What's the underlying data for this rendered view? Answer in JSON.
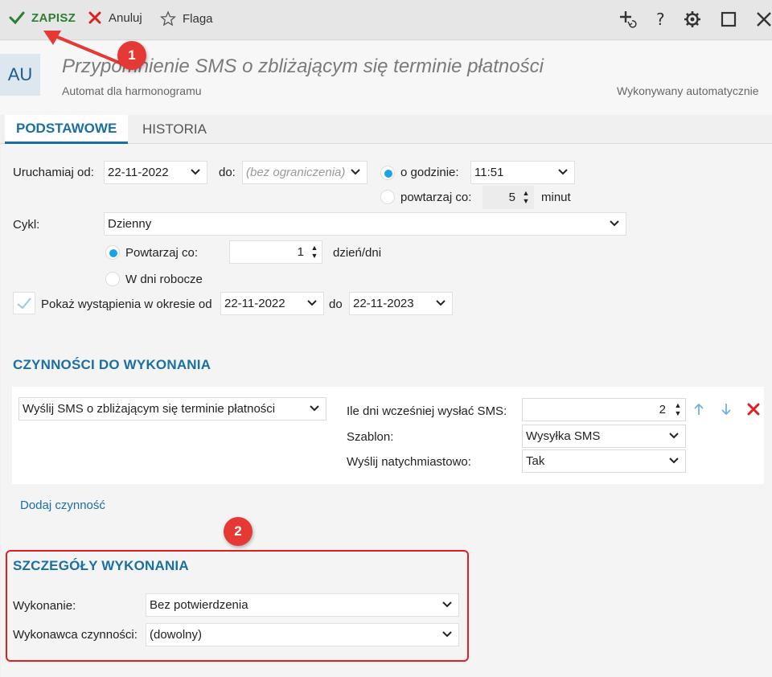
{
  "toolbar": {
    "save_label": "ZAPISZ",
    "cancel_label": "Anuluj",
    "flag_label": "Flaga"
  },
  "header": {
    "badge": "AU",
    "title": "Przypomnienie SMS o zbliżającym się terminie płatności",
    "subtitle": "Automat dla harmonogramu",
    "right_note": "Wykonywany automatycznie"
  },
  "tabs": [
    {
      "label": "PODSTAWOWE",
      "active": true
    },
    {
      "label": "HISTORIA",
      "active": false
    }
  ],
  "schedule": {
    "run_from_label": "Uruchamiaj od:",
    "run_from_value": "22-11-2022",
    "to_label": "do:",
    "to_placeholder": "(bez ograniczenia)",
    "at_hour_label": "o godzinie:",
    "at_hour_value": "11:51",
    "repeat_every_label": "powtarzaj co:",
    "repeat_every_value": "5",
    "repeat_every_unit": "minut",
    "mode_selected": "at_hour"
  },
  "cycle": {
    "label": "Cykl:",
    "value": "Dzienny",
    "repeat_label": "Powtarzaj co:",
    "repeat_value": "1",
    "repeat_unit": "dzień/dni",
    "workdays_label": "W dni robocze",
    "selected": "repeat"
  },
  "show_occurrences": {
    "label": "Pokaż wystąpienia w okresie od",
    "from_value": "22-11-2022",
    "to_label": "do",
    "to_value": "22-11-2023",
    "checked": true
  },
  "actions": {
    "heading": "CZYNNOŚCI DO WYKONANIA",
    "action_value": "Wyślij SMS o zbliżającym się terminie płatności",
    "days_before_label": "Ile dni wcześniej wysłać SMS:",
    "days_before_value": "2",
    "template_label": "Szablon:",
    "template_value": "Wysyłka SMS",
    "send_now_label": "Wyślij natychmiastowo:",
    "send_now_value": "Tak",
    "add_link": "Dodaj czynność"
  },
  "details": {
    "heading": "SZCZEGÓŁY WYKONANIA",
    "execution_label": "Wykonanie:",
    "execution_value": "Bez potwierdzenia",
    "executor_label": "Wykonawca czynności:",
    "executor_value": "(dowolny)"
  },
  "callouts": [
    "1",
    "2"
  ],
  "colors": {
    "accent": "#1a6fa3",
    "save_green": "#2e7d32",
    "danger_red": "#e02020",
    "radio_blue": "#1aa3e8"
  },
  "icons": {
    "save": "check-icon",
    "cancel": "x-icon",
    "flag": "star-icon",
    "add_sub": "add-refresh-icon",
    "help": "question-icon",
    "settings": "gear-icon",
    "maximize": "square-icon",
    "close": "close-icon"
  }
}
